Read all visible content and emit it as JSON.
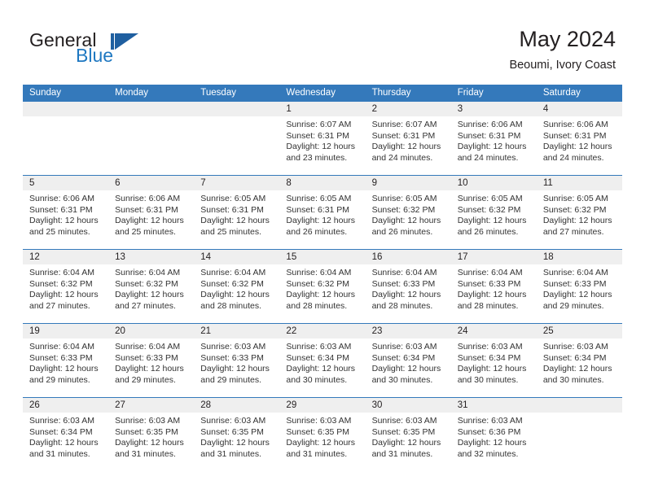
{
  "brand": {
    "word1": "General",
    "word2": "Blue",
    "mark": "triangle-logo"
  },
  "header": {
    "title": "May 2024",
    "subtitle": "Beoumi, Ivory Coast"
  },
  "colors": {
    "header_blue": "#3479bb",
    "row_band_gray": "#efefef",
    "brand_blue": "#1f78c1",
    "text": "#231f20"
  },
  "weekdays": [
    "Sunday",
    "Monday",
    "Tuesday",
    "Wednesday",
    "Thursday",
    "Friday",
    "Saturday"
  ],
  "weeks": [
    {
      "days": [
        {
          "num": "",
          "lines": []
        },
        {
          "num": "",
          "lines": []
        },
        {
          "num": "",
          "lines": []
        },
        {
          "num": "1",
          "lines": [
            "Sunrise: 6:07 AM",
            "Sunset: 6:31 PM",
            "Daylight: 12 hours",
            "and 23 minutes."
          ]
        },
        {
          "num": "2",
          "lines": [
            "Sunrise: 6:07 AM",
            "Sunset: 6:31 PM",
            "Daylight: 12 hours",
            "and 24 minutes."
          ]
        },
        {
          "num": "3",
          "lines": [
            "Sunrise: 6:06 AM",
            "Sunset: 6:31 PM",
            "Daylight: 12 hours",
            "and 24 minutes."
          ]
        },
        {
          "num": "4",
          "lines": [
            "Sunrise: 6:06 AM",
            "Sunset: 6:31 PM",
            "Daylight: 12 hours",
            "and 24 minutes."
          ]
        }
      ]
    },
    {
      "days": [
        {
          "num": "5",
          "lines": [
            "Sunrise: 6:06 AM",
            "Sunset: 6:31 PM",
            "Daylight: 12 hours",
            "and 25 minutes."
          ]
        },
        {
          "num": "6",
          "lines": [
            "Sunrise: 6:06 AM",
            "Sunset: 6:31 PM",
            "Daylight: 12 hours",
            "and 25 minutes."
          ]
        },
        {
          "num": "7",
          "lines": [
            "Sunrise: 6:05 AM",
            "Sunset: 6:31 PM",
            "Daylight: 12 hours",
            "and 25 minutes."
          ]
        },
        {
          "num": "8",
          "lines": [
            "Sunrise: 6:05 AM",
            "Sunset: 6:31 PM",
            "Daylight: 12 hours",
            "and 26 minutes."
          ]
        },
        {
          "num": "9",
          "lines": [
            "Sunrise: 6:05 AM",
            "Sunset: 6:32 PM",
            "Daylight: 12 hours",
            "and 26 minutes."
          ]
        },
        {
          "num": "10",
          "lines": [
            "Sunrise: 6:05 AM",
            "Sunset: 6:32 PM",
            "Daylight: 12 hours",
            "and 26 minutes."
          ]
        },
        {
          "num": "11",
          "lines": [
            "Sunrise: 6:05 AM",
            "Sunset: 6:32 PM",
            "Daylight: 12 hours",
            "and 27 minutes."
          ]
        }
      ]
    },
    {
      "days": [
        {
          "num": "12",
          "lines": [
            "Sunrise: 6:04 AM",
            "Sunset: 6:32 PM",
            "Daylight: 12 hours",
            "and 27 minutes."
          ]
        },
        {
          "num": "13",
          "lines": [
            "Sunrise: 6:04 AM",
            "Sunset: 6:32 PM",
            "Daylight: 12 hours",
            "and 27 minutes."
          ]
        },
        {
          "num": "14",
          "lines": [
            "Sunrise: 6:04 AM",
            "Sunset: 6:32 PM",
            "Daylight: 12 hours",
            "and 28 minutes."
          ]
        },
        {
          "num": "15",
          "lines": [
            "Sunrise: 6:04 AM",
            "Sunset: 6:32 PM",
            "Daylight: 12 hours",
            "and 28 minutes."
          ]
        },
        {
          "num": "16",
          "lines": [
            "Sunrise: 6:04 AM",
            "Sunset: 6:33 PM",
            "Daylight: 12 hours",
            "and 28 minutes."
          ]
        },
        {
          "num": "17",
          "lines": [
            "Sunrise: 6:04 AM",
            "Sunset: 6:33 PM",
            "Daylight: 12 hours",
            "and 28 minutes."
          ]
        },
        {
          "num": "18",
          "lines": [
            "Sunrise: 6:04 AM",
            "Sunset: 6:33 PM",
            "Daylight: 12 hours",
            "and 29 minutes."
          ]
        }
      ]
    },
    {
      "days": [
        {
          "num": "19",
          "lines": [
            "Sunrise: 6:04 AM",
            "Sunset: 6:33 PM",
            "Daylight: 12 hours",
            "and 29 minutes."
          ]
        },
        {
          "num": "20",
          "lines": [
            "Sunrise: 6:04 AM",
            "Sunset: 6:33 PM",
            "Daylight: 12 hours",
            "and 29 minutes."
          ]
        },
        {
          "num": "21",
          "lines": [
            "Sunrise: 6:03 AM",
            "Sunset: 6:33 PM",
            "Daylight: 12 hours",
            "and 29 minutes."
          ]
        },
        {
          "num": "22",
          "lines": [
            "Sunrise: 6:03 AM",
            "Sunset: 6:34 PM",
            "Daylight: 12 hours",
            "and 30 minutes."
          ]
        },
        {
          "num": "23",
          "lines": [
            "Sunrise: 6:03 AM",
            "Sunset: 6:34 PM",
            "Daylight: 12 hours",
            "and 30 minutes."
          ]
        },
        {
          "num": "24",
          "lines": [
            "Sunrise: 6:03 AM",
            "Sunset: 6:34 PM",
            "Daylight: 12 hours",
            "and 30 minutes."
          ]
        },
        {
          "num": "25",
          "lines": [
            "Sunrise: 6:03 AM",
            "Sunset: 6:34 PM",
            "Daylight: 12 hours",
            "and 30 minutes."
          ]
        }
      ]
    },
    {
      "days": [
        {
          "num": "26",
          "lines": [
            "Sunrise: 6:03 AM",
            "Sunset: 6:34 PM",
            "Daylight: 12 hours",
            "and 31 minutes."
          ]
        },
        {
          "num": "27",
          "lines": [
            "Sunrise: 6:03 AM",
            "Sunset: 6:35 PM",
            "Daylight: 12 hours",
            "and 31 minutes."
          ]
        },
        {
          "num": "28",
          "lines": [
            "Sunrise: 6:03 AM",
            "Sunset: 6:35 PM",
            "Daylight: 12 hours",
            "and 31 minutes."
          ]
        },
        {
          "num": "29",
          "lines": [
            "Sunrise: 6:03 AM",
            "Sunset: 6:35 PM",
            "Daylight: 12 hours",
            "and 31 minutes."
          ]
        },
        {
          "num": "30",
          "lines": [
            "Sunrise: 6:03 AM",
            "Sunset: 6:35 PM",
            "Daylight: 12 hours",
            "and 31 minutes."
          ]
        },
        {
          "num": "31",
          "lines": [
            "Sunrise: 6:03 AM",
            "Sunset: 6:36 PM",
            "Daylight: 12 hours",
            "and 32 minutes."
          ]
        },
        {
          "num": "",
          "lines": []
        }
      ]
    }
  ]
}
